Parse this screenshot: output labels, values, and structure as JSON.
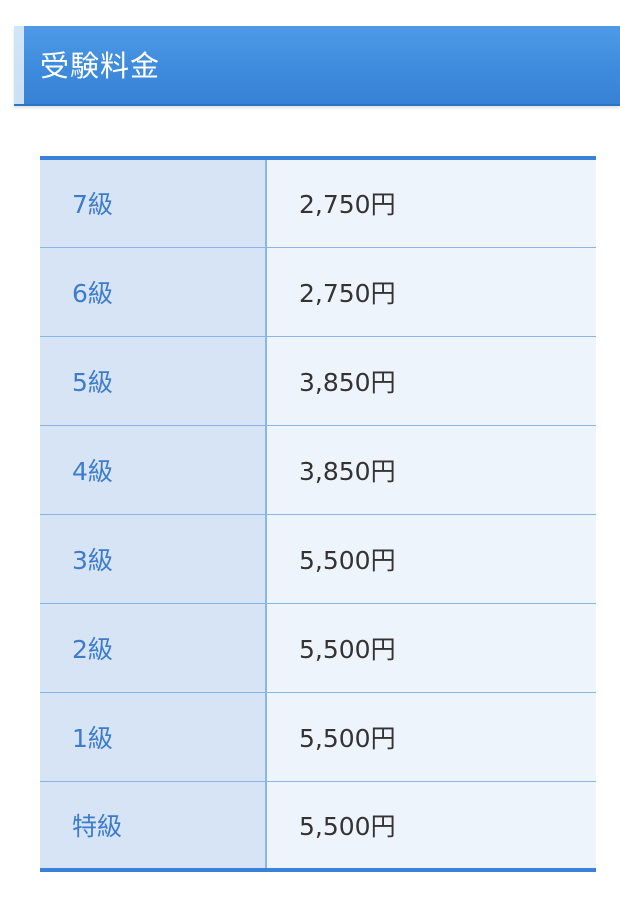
{
  "header": {
    "title": "受験料金"
  },
  "fees": [
    {
      "grade": "7級",
      "price": "2,750円"
    },
    {
      "grade": "6級",
      "price": "2,750円"
    },
    {
      "grade": "5級",
      "price": "3,850円"
    },
    {
      "grade": "4級",
      "price": "3,850円"
    },
    {
      "grade": "3級",
      "price": "5,500円"
    },
    {
      "grade": "2級",
      "price": "5,500円"
    },
    {
      "grade": "1級",
      "price": "5,500円"
    },
    {
      "grade": "特級",
      "price": "5,500円"
    }
  ],
  "colors": {
    "header_blue": "#3e8bdd",
    "grade_text": "#3d7ccd",
    "grade_bg": "#d7e4f6",
    "fee_bg": "#eef4fc",
    "table_border": "#3a82d9"
  }
}
